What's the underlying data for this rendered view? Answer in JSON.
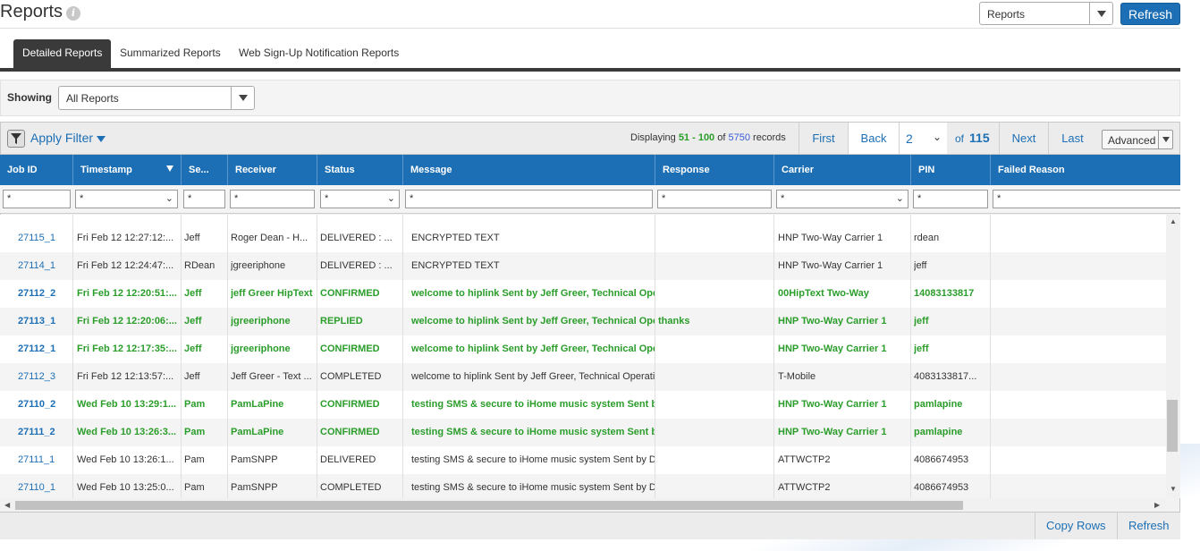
{
  "header": {
    "title": "Reports",
    "report_select": "Reports",
    "refresh_label": "Refresh"
  },
  "tabs": [
    {
      "label": "Detailed Reports",
      "active": true
    },
    {
      "label": "Summarized Reports",
      "active": false
    },
    {
      "label": "Web Sign-Up Notification Reports",
      "active": false
    }
  ],
  "showing": {
    "label": "Showing",
    "value": "All Reports"
  },
  "toolbar": {
    "apply_filter_label": "Apply Filter",
    "displaying_prefix": "Displaying",
    "range": "51 - 100",
    "of_label": "of",
    "total_records": "5750",
    "records_label": "records",
    "first_label": "First",
    "back_label": "Back",
    "current_page": "2",
    "of_pages_label": "of",
    "total_pages": "115",
    "next_label": "Next",
    "last_label": "Last",
    "advanced_label": "Advanced"
  },
  "columns": [
    "Job ID",
    "Timestamp",
    "Se...",
    "Receiver",
    "Status",
    "Message",
    "Response",
    "Carrier",
    "PIN",
    "Failed Reason"
  ],
  "filters": [
    "*",
    "*",
    "*",
    "*",
    "*",
    "*",
    "*",
    "*",
    "*",
    "*"
  ],
  "rows": [
    {
      "job_id": "27115_1",
      "timestamp": "Fri Feb 12 12:27:12:...",
      "sender": "Jeff",
      "receiver": "Roger Dean - H...",
      "status": "DELIVERED : ...",
      "message": "ENCRYPTED TEXT",
      "response": "",
      "carrier": "HNP Two-Way Carrier 1",
      "pin": "rdean",
      "failed": "",
      "highlight": false
    },
    {
      "job_id": "27114_1",
      "timestamp": "Fri Feb 12 12:24:47:...",
      "sender": "RDean",
      "receiver": "jgreeriphone",
      "status": "DELIVERED : ...",
      "message": "ENCRYPTED TEXT",
      "response": "",
      "carrier": "HNP Two-Way Carrier 1",
      "pin": "jeff",
      "failed": "",
      "highlight": false
    },
    {
      "job_id": "27112_2",
      "timestamp": "Fri Feb 12 12:20:51:...",
      "sender": "Jeff",
      "receiver": "jeff Greer HipText",
      "status": "CONFIRMED",
      "message": "welcome to hiplink Sent by Jeff Greer, Technical Ope",
      "response": "",
      "carrier": "00HipText Two-Way",
      "pin": "14083133817",
      "failed": "",
      "highlight": true
    },
    {
      "job_id": "27113_1",
      "timestamp": "Fri Feb 12 12:20:06:...",
      "sender": "Jeff",
      "receiver": "jgreeriphone",
      "status": "REPLIED",
      "message": "welcome to hiplink Sent by Jeff Greer, Technical Ope",
      "response": "thanks",
      "carrier": "HNP Two-Way Carrier 1",
      "pin": "jeff",
      "failed": "",
      "highlight": true
    },
    {
      "job_id": "27112_1",
      "timestamp": "Fri Feb 12 12:17:35:...",
      "sender": "Jeff",
      "receiver": "jgreeriphone",
      "status": "CONFIRMED",
      "message": "welcome to hiplink Sent by Jeff Greer, Technical Ope",
      "response": "",
      "carrier": "HNP Two-Way Carrier 1",
      "pin": "jeff",
      "failed": "",
      "highlight": true
    },
    {
      "job_id": "27112_3",
      "timestamp": "Fri Feb 12 12:13:57:...",
      "sender": "Jeff",
      "receiver": "Jeff Greer - Text ...",
      "status": "COMPLETED",
      "message": "welcome to hiplink Sent by Jeff Greer, Technical Operati",
      "response": "",
      "carrier": "T-Mobile",
      "pin": "4083133817...",
      "failed": "",
      "highlight": false
    },
    {
      "job_id": "27110_2",
      "timestamp": "Wed Feb 10 13:29:1...",
      "sender": "Pam",
      "receiver": "PamLaPine",
      "status": "CONFIRMED",
      "message": "testing SMS & secure to iHome music system Sent b",
      "response": "",
      "carrier": "HNP Two-Way Carrier 1",
      "pin": "pamlapine",
      "failed": "",
      "highlight": true
    },
    {
      "job_id": "27111_2",
      "timestamp": "Wed Feb 10 13:26:3...",
      "sender": "Pam",
      "receiver": "PamLaPine",
      "status": "CONFIRMED",
      "message": "testing SMS & secure to iHome music system Sent b",
      "response": "",
      "carrier": "HNP Two-Way Carrier 1",
      "pin": "pamlapine",
      "failed": "",
      "highlight": true
    },
    {
      "job_id": "27111_1",
      "timestamp": "Wed Feb 10 13:26:1...",
      "sender": "Pam",
      "receiver": "PamSNPP",
      "status": "DELIVERED",
      "message": "testing SMS & secure to iHome music system Sent by D",
      "response": "",
      "carrier": "ATTWCTP2",
      "pin": "4086674953",
      "failed": "",
      "highlight": false
    },
    {
      "job_id": "27110_1",
      "timestamp": "Wed Feb 10 13:25:0...",
      "sender": "Pam",
      "receiver": "PamSNPP",
      "status": "COMPLETED",
      "message": "testing SMS & secure to iHome music system Sent by D",
      "response": "",
      "carrier": "ATTWCTP2",
      "pin": "4086674953",
      "failed": "",
      "highlight": false
    }
  ],
  "footer": {
    "copy_rows_label": "Copy Rows",
    "refresh_label": "Refresh"
  },
  "colors": {
    "accent_blue": "#1c6fb5",
    "success_green": "#2a9d2a",
    "tab_dark": "#3a3a3a"
  }
}
